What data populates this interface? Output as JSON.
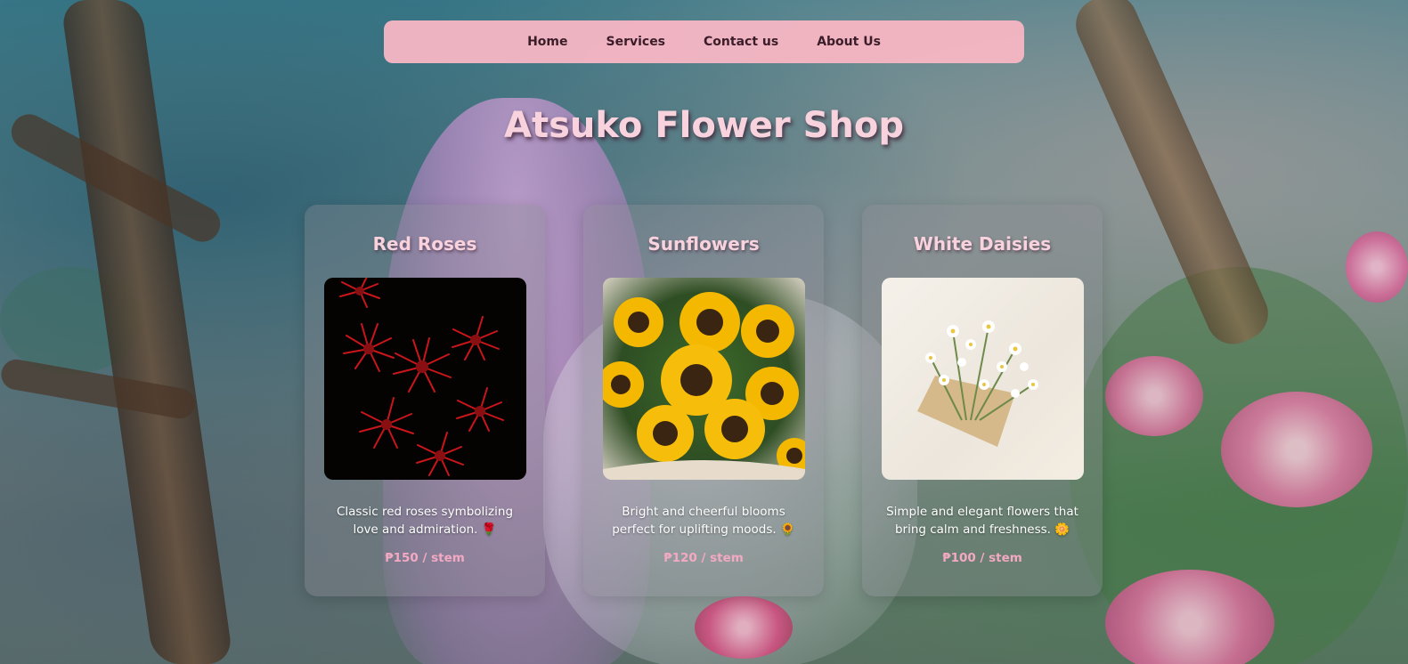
{
  "nav": {
    "items": [
      {
        "label": "Home"
      },
      {
        "label": "Services"
      },
      {
        "label": "Contact us"
      },
      {
        "label": "About Us"
      }
    ]
  },
  "header": {
    "title": "Atsuko Flower Shop"
  },
  "products": [
    {
      "name": "Red Roses",
      "description": "Classic red roses symbolizing love and admiration. 🌹",
      "price": "₱150 / stem",
      "image_icon": "red-flowers-photo"
    },
    {
      "name": "Sunflowers",
      "description": "Bright and cheerful blooms perfect for uplifting moods. 🌻",
      "price": "₱120 / stem",
      "image_icon": "sunflowers-photo"
    },
    {
      "name": "White Daisies",
      "description": "Simple and elegant flowers that bring calm and freshness. 🌼",
      "price": "₱100 / stem",
      "image_icon": "daisies-photo"
    }
  ],
  "colors": {
    "nav_bg": "#f8b6c4",
    "title_text": "#f8d3de",
    "price_text": "#f4a9c3"
  }
}
